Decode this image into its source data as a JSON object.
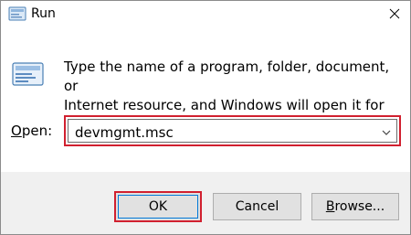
{
  "window": {
    "title": "Run"
  },
  "dialog": {
    "description_line1": "Type the name of a program, folder, document, or",
    "description_line2": "Internet resource, and Windows will open it for you.",
    "open_label_prefix": "O",
    "open_label_rest": "pen:",
    "open_value": "devmgmt.msc"
  },
  "buttons": {
    "ok": "OK",
    "cancel": "Cancel",
    "browse_prefix": "B",
    "browse_rest": "rowse..."
  },
  "icons": {
    "title": "run-icon",
    "main": "run-icon",
    "close": "close-icon",
    "dropdown": "chevron-down-icon"
  },
  "colors": {
    "highlight": "#d1202f",
    "focus": "#0078d7"
  }
}
